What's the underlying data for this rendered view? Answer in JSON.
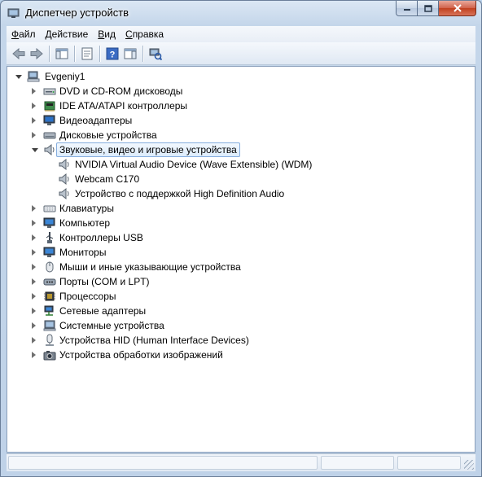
{
  "window": {
    "title": "Диспетчер устройств"
  },
  "menu": {
    "items": [
      {
        "label": "Файл",
        "ul": "Ф",
        "rest": "айл"
      },
      {
        "label": "Действие",
        "ul": "Д",
        "rest": "ействие"
      },
      {
        "label": "Вид",
        "ul": "В",
        "rest": "ид"
      },
      {
        "label": "Справка",
        "ul": "С",
        "rest": "правка"
      }
    ]
  },
  "toolbar": {
    "buttons": [
      "back-icon",
      "forward-icon",
      "show-hide-tree-icon",
      "properties-icon",
      "help-icon",
      "action-pane-icon",
      "scan-hardware-icon"
    ]
  },
  "tree": {
    "root": {
      "label": "Evgeniy1",
      "icon": "computer-icon"
    },
    "categories": [
      {
        "label": "DVD и CD-ROM дисководы",
        "icon": "dvd-drive-icon"
      },
      {
        "label": "IDE ATA/ATAPI контроллеры",
        "icon": "ide-controller-icon"
      },
      {
        "label": "Видеоадаптеры",
        "icon": "display-adapter-icon"
      },
      {
        "label": "Дисковые устройства",
        "icon": "disk-drive-icon"
      },
      {
        "label": "Звуковые, видео и игровые устройства",
        "icon": "speaker-icon",
        "expanded": true,
        "selected": true,
        "children": [
          {
            "label": "NVIDIA Virtual Audio Device (Wave Extensible) (WDM)",
            "icon": "speaker-icon"
          },
          {
            "label": "Webcam C170",
            "icon": "speaker-icon"
          },
          {
            "label": "Устройство с поддержкой High Definition Audio",
            "icon": "speaker-icon"
          }
        ]
      },
      {
        "label": "Клавиатуры",
        "icon": "keyboard-icon"
      },
      {
        "label": "Компьютер",
        "icon": "monitor-icon"
      },
      {
        "label": "Контроллеры USB",
        "icon": "usb-icon"
      },
      {
        "label": "Мониторы",
        "icon": "monitor-icon"
      },
      {
        "label": "Мыши и иные указывающие устройства",
        "icon": "mouse-icon"
      },
      {
        "label": "Порты (COM и LPT)",
        "icon": "port-icon"
      },
      {
        "label": "Процессоры",
        "icon": "processor-icon"
      },
      {
        "label": "Сетевые адаптеры",
        "icon": "network-adapter-icon"
      },
      {
        "label": "Системные устройства",
        "icon": "system-device-icon"
      },
      {
        "label": "Устройства HID (Human Interface Devices)",
        "icon": "hid-icon"
      },
      {
        "label": "Устройства обработки изображений",
        "icon": "camera-icon"
      }
    ]
  }
}
